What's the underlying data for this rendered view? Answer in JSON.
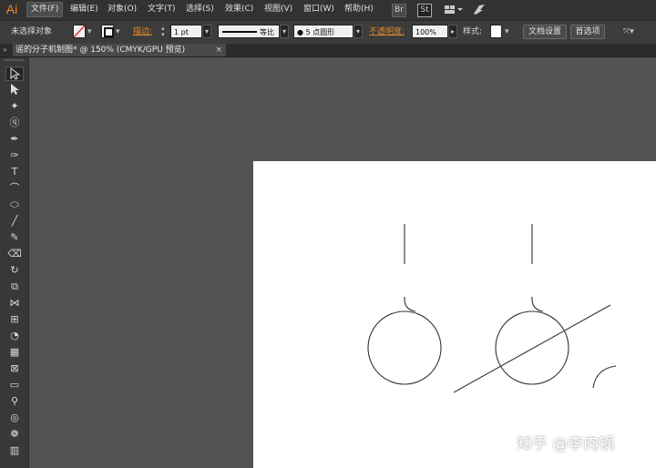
{
  "app": {
    "logo": "Ai"
  },
  "menu": [
    "文件(F)",
    "编辑(E)",
    "对象(O)",
    "文字(T)",
    "选择(S)",
    "效果(C)",
    "视图(V)",
    "窗口(W)",
    "帮助(H)"
  ],
  "top_icons": {
    "br": "Br",
    "st": "St"
  },
  "control_bar": {
    "selection_label": "未选择对象",
    "stroke_label": "描边:",
    "stroke_weight": "1 pt",
    "stroke_profile": "等比",
    "brush": "● 5 点圆形",
    "opacity_label": "不透明度:",
    "opacity_value": "100%",
    "style_label": "样式:",
    "doc_setup_button": "文档设置",
    "preferences_button": "首选项"
  },
  "document_tab": {
    "title": "谣的分子机制图* @ 150% (CMYK/GPU 预览)",
    "close": "×"
  },
  "watermark": "知乎 @李肉锅",
  "colors": {
    "accent_orange": "#e0892d",
    "panel_bg": "#383838",
    "canvas_bg": "#535353",
    "artboard": "#ffffff"
  },
  "tools": [
    "selection-tool",
    "direct-selection-tool",
    "magic-wand-tool",
    "lasso-tool",
    "pen-tool",
    "curvature-tool",
    "type-tool",
    "arc-tool",
    "ellipse-tool",
    "paintbrush-tool",
    "pencil-tool",
    "eraser-tool",
    "rotate-tool",
    "scale-tool",
    "width-tool",
    "free-transform-tool",
    "shape-builder-tool",
    "perspective-grid-tool",
    "mesh-tool",
    "gradient-tool",
    "eyedropper-tool",
    "blend-tool",
    "symbol-sprayer-tool",
    "column-graph-tool"
  ]
}
